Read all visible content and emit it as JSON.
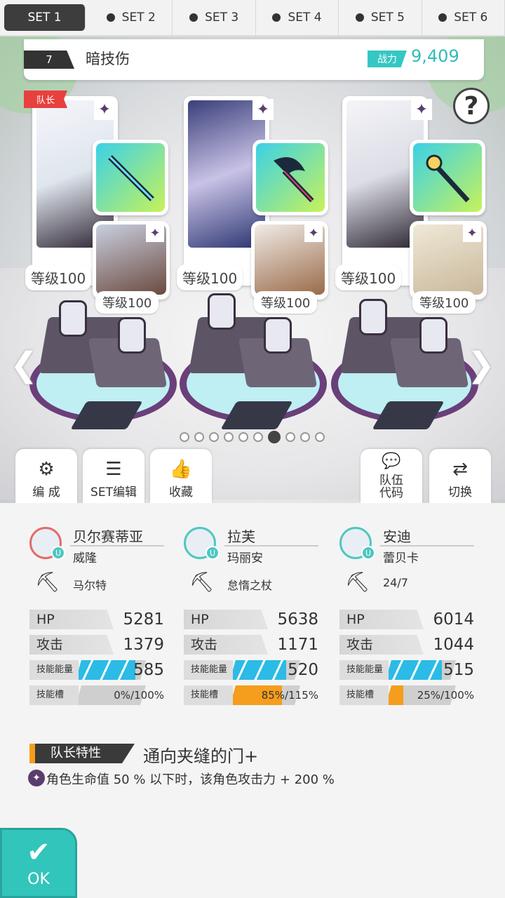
{
  "tabs": [
    {
      "label": "SET 1",
      "active": true
    },
    {
      "label": "SET 2",
      "active": false
    },
    {
      "label": "SET 3",
      "active": false
    },
    {
      "label": "SET 4",
      "active": false
    },
    {
      "label": "SET 5",
      "active": false
    },
    {
      "label": "SET 6",
      "active": false
    }
  ],
  "team": {
    "number": "7",
    "name": "暗技伤",
    "power_label": "战力",
    "power_value": "9,409"
  },
  "help_label": "?",
  "leader_badge": "队长",
  "slots": [
    {
      "main_level": "等级100",
      "sub_level": "等级100"
    },
    {
      "main_level": "等级100",
      "sub_level": "等级100"
    },
    {
      "main_level": "等级100",
      "sub_level": "等级100"
    }
  ],
  "scene_buttons": {
    "formation": "编 成",
    "set_edit": "SET编辑",
    "favorite": "收藏",
    "team_code": "队伍\n代码",
    "switch": "切换"
  },
  "characters": [
    {
      "name": "贝尔赛蒂亚",
      "sub": "威隆",
      "weapon": "马尔特",
      "hp": "5281",
      "atk": "1379",
      "energy": "585",
      "slot": "0%/100%",
      "energy_fill": 0.85,
      "slot_fill": 0.0,
      "avatar_color": "#e56a6a"
    },
    {
      "name": "拉芙",
      "sub": "玛丽安",
      "weapon": "怠惰之杖",
      "hp": "5638",
      "atk": "1171",
      "energy": "520",
      "slot": "85%/115%",
      "energy_fill": 0.8,
      "slot_fill": 0.74,
      "avatar_color": "#4ec7c0"
    },
    {
      "name": "安迪",
      "sub": "蕾贝卡",
      "weapon": "24/7",
      "hp": "6014",
      "atk": "1044",
      "energy": "515",
      "slot": "25%/100%",
      "energy_fill": 0.8,
      "slot_fill": 0.25,
      "avatar_color": "#4ec7c0"
    }
  ],
  "labels": {
    "hp": "HP",
    "atk": "攻击",
    "energy": "技能能量",
    "slot": "技能槽"
  },
  "leader_skill": {
    "label": "队长特性",
    "name": "通向夹缝的门+",
    "desc": "角色生命值 50 % 以下时，该角色攻击力 + 200 %"
  },
  "ok_label": "OK",
  "page_dots": {
    "count": 10,
    "current": 6
  },
  "colors": {
    "accent": "#32c5bc",
    "energy": "#2bbbe6",
    "slot": "#f59d1c",
    "leader": "#e8403f"
  }
}
